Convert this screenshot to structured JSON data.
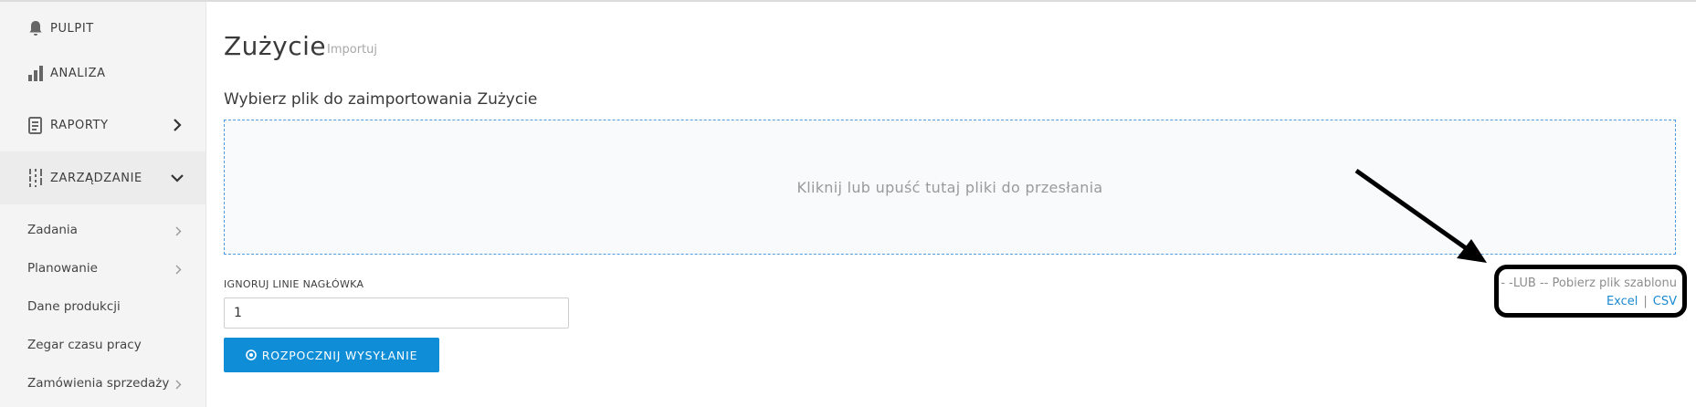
{
  "sidebar": {
    "items": [
      {
        "label": "PULPIT",
        "icon": "bell-icon"
      },
      {
        "label": "ANALIZA",
        "icon": "bar-chart-icon"
      },
      {
        "label": "RAPORTY",
        "icon": "report-icon"
      },
      {
        "label": "ZARZĄDZANIE",
        "icon": "sliders-icon"
      }
    ],
    "subitems": [
      {
        "label": "Zadania"
      },
      {
        "label": "Planowanie"
      },
      {
        "label": "Dane produkcji"
      },
      {
        "label": "Zegar czasu pracy"
      },
      {
        "label": "Zamówienia sprzedaży"
      }
    ]
  },
  "main": {
    "title": "Zużycie",
    "subtitle": "Importuj",
    "section_title": "Wybierz plik do zaimportowania Zużycie",
    "dropzone_text": "Kliknij lub upuść tutaj pliki do przesłania",
    "header_lines_label": "IGNORUJ LINIE NAGŁÓWKA",
    "header_lines_value": "1",
    "start_button": "ROZPOCZNIJ WYSYŁANIE",
    "template_text": "- -LUB -- Pobierz plik szablonu",
    "link_excel": "Excel",
    "link_separator": "|",
    "link_csv": "CSV"
  },
  "colors": {
    "accent": "#0f8dd7",
    "link": "#1a8ad0",
    "dropzone_border": "#4f9be0",
    "sidebar_bg": "#f4f4f4"
  }
}
